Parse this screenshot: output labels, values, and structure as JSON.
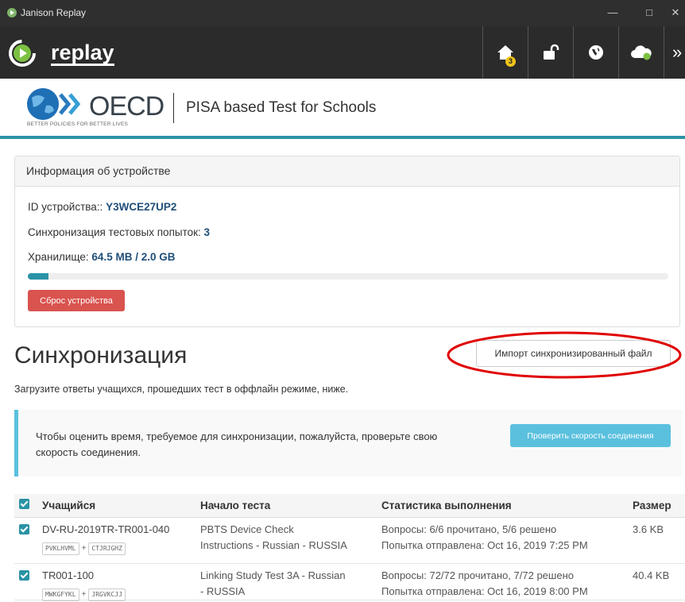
{
  "window": {
    "title": "Janison Replay",
    "controls": [
      "—",
      "□",
      "✕"
    ]
  },
  "appbar": {
    "logo_text": "replay",
    "nav": [
      {
        "icon": "home-icon",
        "badge": "3"
      },
      {
        "icon": "unlock-icon"
      },
      {
        "icon": "globe-icon"
      },
      {
        "icon": "cloud-icon"
      }
    ],
    "more": "»"
  },
  "header": {
    "oecd": "OECD",
    "tagline": "BETTER POLICIES FOR BETTER LIVES",
    "subtitle": "PISA based Test for Schools"
  },
  "device": {
    "heading": "Информация об устройстве",
    "id_label": "ID устройства::",
    "id_value": "Y3WCE27UP2",
    "sync_label": "Синхронизация тестовых попыток:",
    "sync_value": "3",
    "storage_label": "Хранилище:",
    "storage_value": "64.5 MB / 2.0 GB",
    "storage_fraction": 0.032,
    "reset_button": "Сброс устройства"
  },
  "sync": {
    "title": "Синхронизация",
    "import_button": "Импорт синхронизированный файл",
    "subtitle": "Загрузите ответы учащихся, прошедших тест в оффлайн режиме, ниже.",
    "callout_text": "Чтобы оценить время, требуемое для синхронизации, пожалуйста, проверьте свою скорость соединения.",
    "speed_button": "Проверить скорость соединения"
  },
  "table": {
    "headers": [
      "Учащийся",
      "Начало теста",
      "Статистика выполнения",
      "Размер"
    ],
    "rows": [
      {
        "student": "DV-RU-2019TR-TR001-040",
        "code1": "PVKLHVML",
        "code2": "CTJRJGHZ",
        "test_line1": "PBTS Device Check",
        "test_line2": "Instructions - Russian - RUSSIA",
        "stats_line1": "Вопросы: 6/6 прочитано, 5/6 решено",
        "stats_line2": "Попытка отправлена: Oct 16, 2019 7:25 PM",
        "size": "3.6 KB"
      },
      {
        "student": "TR001-100",
        "code1": "MWKGFYKL",
        "code2": "JRGVKCJJ",
        "test_line1": "Linking Study Test 3A - Russian",
        "test_line2": "- RUSSIA",
        "stats_line1": "Вопросы: 72/72 прочитано, 7/72 решено",
        "stats_line2": "Попытка отправлена: Oct 16, 2019 8:00 PM",
        "size": "40.4 KB"
      }
    ]
  },
  "colors": {
    "teal": "#2a93a6",
    "danger": "#d9534f",
    "info": "#5bc0de",
    "annotation": "#e00000"
  }
}
